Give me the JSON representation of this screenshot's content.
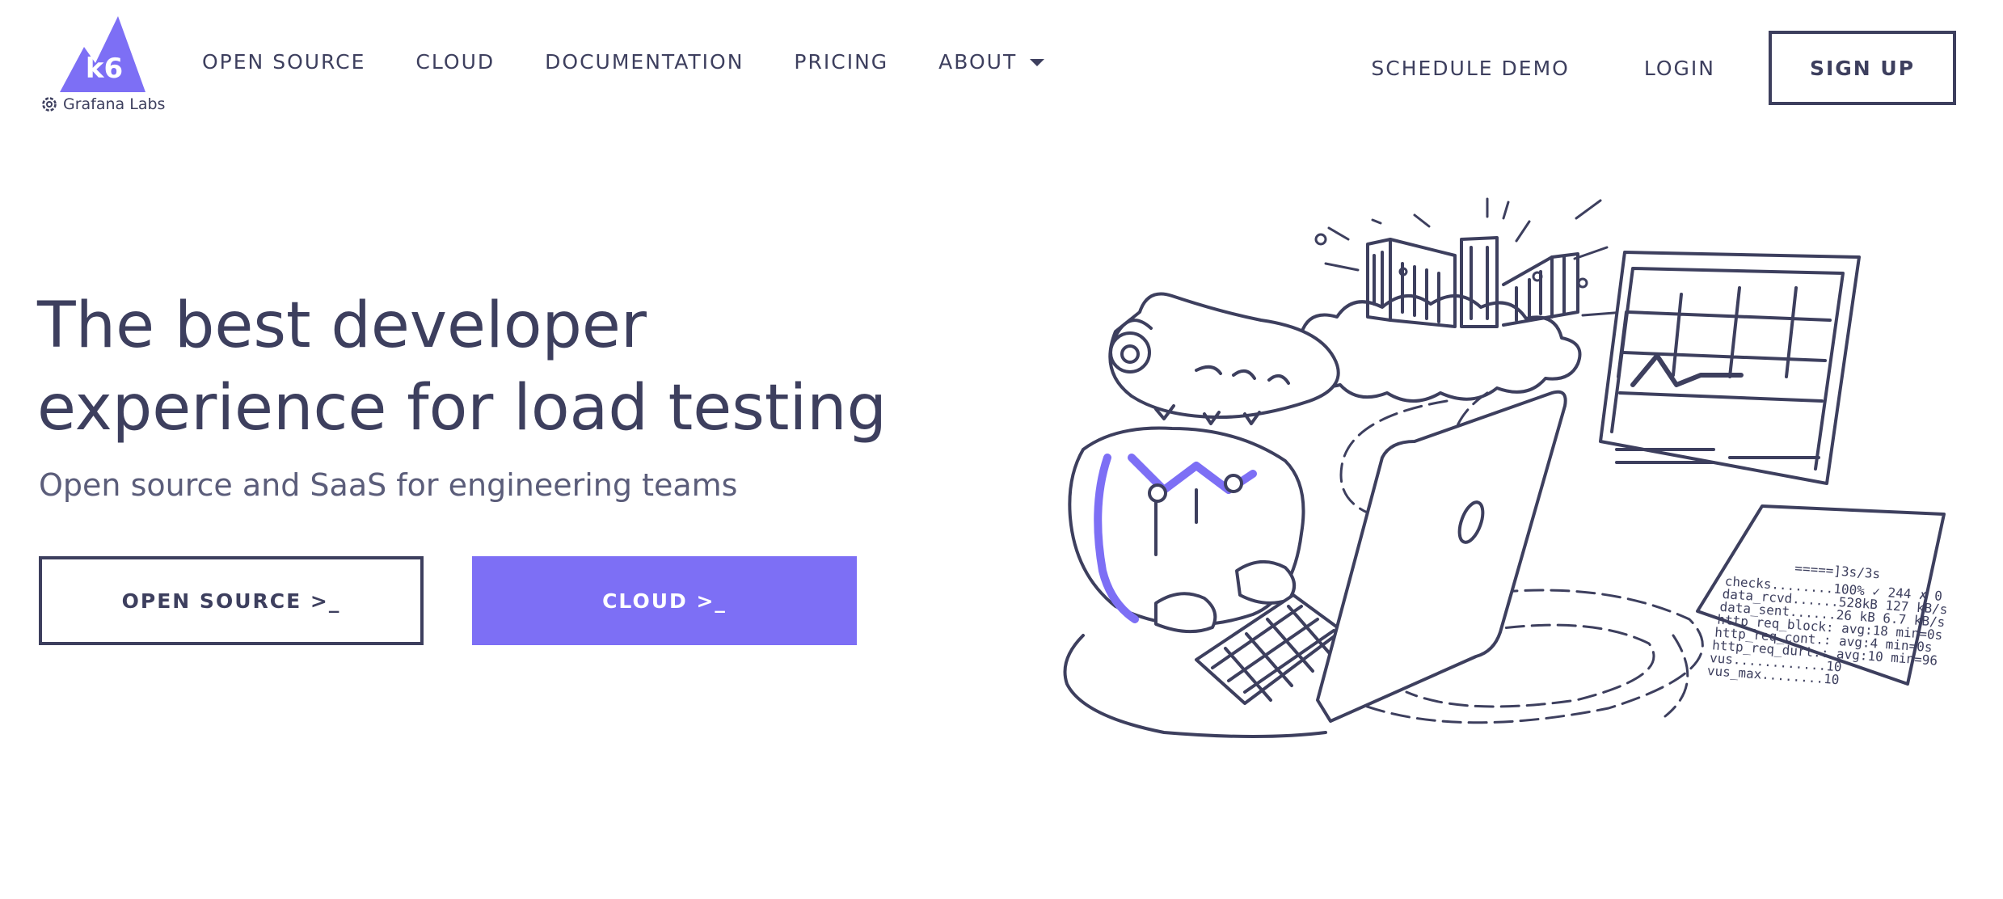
{
  "logo": {
    "mark_text": "k6",
    "brand_text": "Grafana Labs",
    "mark_color": "#7d6ff5"
  },
  "nav": {
    "items": [
      {
        "label": "OPEN SOURCE"
      },
      {
        "label": "CLOUD"
      },
      {
        "label": "DOCUMENTATION"
      },
      {
        "label": "PRICING"
      },
      {
        "label": "ABOUT",
        "has_dropdown": true
      }
    ],
    "schedule_demo": "SCHEDULE DEMO",
    "login": "LOGIN",
    "signup": "SIGN UP"
  },
  "hero": {
    "title_line1": "The best developer",
    "title_line2": "experience for load testing",
    "subtitle": "Open source and SaaS for engineering teams",
    "cta_open_source": "OPEN SOURCE >_",
    "cta_cloud": "CLOUD >_"
  },
  "illustration": {
    "terminal_lines": [
      "checks........100% ✓ 244 ✗ 0",
      "data_rcvd......528kB 127 kB/s",
      "data_sent......26 kB 6.7 kB/s",
      "http_req_block: avg:18 min=0s",
      "http_req_cont.: avg:4  min=0s",
      "http_req_durt.: avg:10 min=96",
      "vus............10",
      "vus_max........10"
    ],
    "terminal_progress": "=====]3s/3s"
  },
  "colors": {
    "text": "#3d3f5e",
    "accent": "#7d6ff5",
    "background": "#ffffff"
  }
}
